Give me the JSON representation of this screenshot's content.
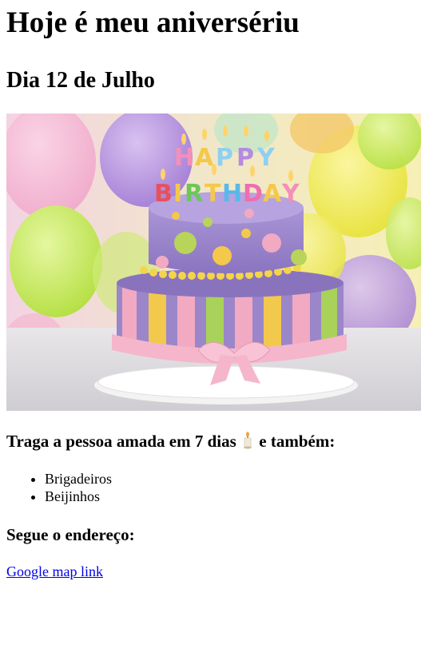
{
  "page": {
    "title": "Hoje é meu aniversériu",
    "date": "Dia 12 de Julho",
    "image_text": "HAPPY BIRTHDAY",
    "invite_before_icon": "Traga a pessoa amada em 7 dias",
    "invite_after_icon": "e também:",
    "candle_icon": "candle-icon",
    "items": [
      "Brigadeiros",
      "Beijinhos"
    ],
    "address_heading": "Segue o endereço:",
    "map_link": "Google map link"
  },
  "colors": {
    "link": "#0000ee",
    "cake_purple": "#9b86c9",
    "ribbon_pink": "#f2a9c2",
    "stripe_yellow": "#f2c94c",
    "stripe_green": "#a8d25a"
  }
}
